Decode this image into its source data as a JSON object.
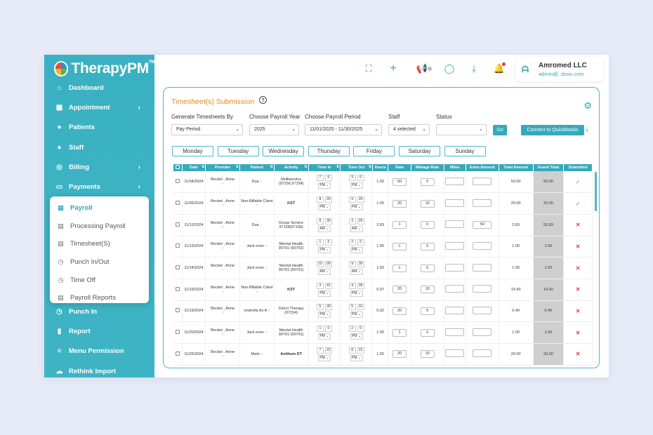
{
  "brand": {
    "name": "TherapyPM",
    "tm": "TM"
  },
  "sidebar": {
    "items": [
      {
        "label": "Dashboard",
        "icon": "home-icon"
      },
      {
        "label": "Appointment",
        "icon": "calendar-icon",
        "chevron": true
      },
      {
        "label": "Patients",
        "icon": "users-icon"
      },
      {
        "label": "Staff",
        "icon": "user-icon"
      },
      {
        "label": "Billing",
        "icon": "billing-icon",
        "chevron": true
      },
      {
        "label": "Payments",
        "icon": "card-icon",
        "chevron": true
      },
      {
        "label": "Punch In",
        "icon": "clock-icon"
      },
      {
        "label": "Report",
        "icon": "chart-icon"
      },
      {
        "label": "Menu Permission",
        "icon": "menu-icon"
      },
      {
        "label": "Rethink Import",
        "icon": "cloud-icon"
      }
    ],
    "submenu": [
      {
        "label": "Payroll",
        "active": true
      },
      {
        "label": "Processing Payroll"
      },
      {
        "label": "Timesheet(S)"
      },
      {
        "label": "Punch In/Out"
      },
      {
        "label": "Time Off"
      },
      {
        "label": "Payroll Reports"
      }
    ]
  },
  "user": {
    "name": "Amromed LLC",
    "email": "admin@..dmin.com"
  },
  "page": {
    "title": "Timesheet(s) Submission"
  },
  "filters": {
    "generate_label": "Generate Timesheets By",
    "generate_value": "Pay Period",
    "year_label": "Choose Payroll Year",
    "year_value": "2025",
    "period_label": "Choose Payroll Period",
    "period_value": "11/01/2025 - 11/30/2025",
    "staff_label": "Staff",
    "staff_value": "4 selected",
    "status_label": "Status",
    "status_value": "",
    "go": "Go",
    "quickbooks": "Connect to QuickBooks"
  },
  "days": [
    "Monday",
    "Tuesday",
    "Wednesday",
    "Thursday",
    "Friday",
    "Saturday",
    "Sunday"
  ],
  "table": {
    "headers": [
      "",
      "Date",
      "Provider",
      "Patient",
      "Activity",
      "Time In",
      "Time Out",
      "Hours",
      "Rate",
      "Mileage Rate",
      "Miles",
      "Extra Amount",
      "Total Amount",
      "Grand Total",
      "Submitted"
    ],
    "rows": [
      {
        "date": "11/04/2024",
        "provider": "Becket , Anne",
        "patient": "Dua",
        "activity": "Multiservice (97156,97154)",
        "in_h": "7",
        "in_m": "0",
        "in_ap": "PM",
        "out_h": "9",
        "out_m": "0",
        "out_ap": "PM",
        "hours": "1.00",
        "rate": "50",
        "mileage": "0",
        "miles": "",
        "extra": "",
        "total": "50.00",
        "grand": "50.00",
        "submitted": true
      },
      {
        "date": "11/05/2024",
        "provider": "Becket , Anne",
        "patient": "Non-Billable Client",
        "activity": "KST",
        "in_h": "8",
        "in_m": "20",
        "in_ap": "PM",
        "out_h": "9",
        "out_m": "20",
        "out_ap": "PM",
        "hours": "1.00",
        "rate": "20",
        "mileage": "10",
        "miles": "",
        "extra": "",
        "total": "20.00",
        "grand": "20.00",
        "submitted": true
      },
      {
        "date": "11/12/2024",
        "provider": "Becket , Anne",
        "patient": "Dua",
        "activity": "Group Service 97158(97158)",
        "in_h": "8",
        "in_m": "30",
        "in_ap": "AM",
        "out_h": "3",
        "out_m": "20",
        "out_ap": "AM",
        "hours": "2.83",
        "rate": "1",
        "mileage": "0",
        "miles": "",
        "extra": "50",
        "total": "2.83",
        "grand": "52.83",
        "submitted": false
      },
      {
        "date": "11/13/2024",
        "provider": "Becket , Anne",
        "patient": "Jack even",
        "activity": "Mental Health 90791 (90791)",
        "in_h": "1",
        "in_m": "0",
        "in_ap": "PM",
        "out_h": "2",
        "out_m": "0",
        "out_ap": "PM",
        "hours": "1.00",
        "rate": "1",
        "mileage": "0",
        "miles": "",
        "extra": "",
        "total": "1.00",
        "grand": "1.00",
        "submitted": false
      },
      {
        "date": "11/14/2024",
        "provider": "Becket , Anne",
        "patient": "Jack even",
        "activity": "Mental Health 90791 (90791)",
        "in_h": "10",
        "in_m": "00",
        "in_ap": "AM",
        "out_h": "9",
        "out_m": "30",
        "out_ap": "AM",
        "hours": "1.50",
        "rate": "1",
        "mileage": "0",
        "miles": "",
        "extra": "",
        "total": "1.50",
        "grand": "1.50",
        "submitted": false
      },
      {
        "date": "11/19/2024",
        "provider": "Becket , Anne",
        "patient": "Non-Billable Client",
        "activity": "KST",
        "in_h": "3",
        "in_m": "41",
        "in_ap": "PM",
        "out_h": "4",
        "out_m": "39",
        "out_ap": "PM",
        "hours": "0.97",
        "rate": "20",
        "mileage": "10",
        "miles": "",
        "extra": "",
        "total": "19.40",
        "grand": "19.40",
        "submitted": false
      },
      {
        "date": "11/19/2024",
        "provider": "Becket , Anne",
        "patient": "cindrella As A",
        "activity": "Direct Therapy (97154)",
        "in_h": "5",
        "in_m": "30",
        "in_ap": "PM",
        "out_h": "5",
        "out_m": "31",
        "out_ap": "PM",
        "hours": "0.02",
        "rate": "20",
        "mileage": "5",
        "miles": "",
        "extra": "",
        "total": "0.40",
        "grand": "0.40",
        "submitted": false
      },
      {
        "date": "11/20/2024",
        "provider": "Becket , Anne",
        "patient": "Jack even",
        "activity": "Mental Health 90791 (90791)",
        "in_h": "1",
        "in_m": "0",
        "in_ap": "PM",
        "out_h": "2",
        "out_m": "0",
        "out_ap": "PM",
        "hours": "1.00",
        "rate": "1",
        "mileage": "0",
        "miles": "",
        "extra": "",
        "total": "1.00",
        "grand": "1.00",
        "submitted": false
      },
      {
        "date": "11/26/2024",
        "provider": "Becket , Anne",
        "patient": "Mark",
        "activity": "Anithem DT",
        "in_h": "7",
        "in_m": "22",
        "in_ap": "PM",
        "out_h": "8",
        "out_m": "22",
        "out_ap": "PM",
        "hours": "1.00",
        "rate": "20",
        "mileage": "10",
        "miles": "",
        "extra": "",
        "total": "20.00",
        "grand": "20.00",
        "submitted": false
      }
    ]
  },
  "colors": {
    "accent": "#36a9bb",
    "title": "#e8861b",
    "reject": "#e23b3b"
  }
}
